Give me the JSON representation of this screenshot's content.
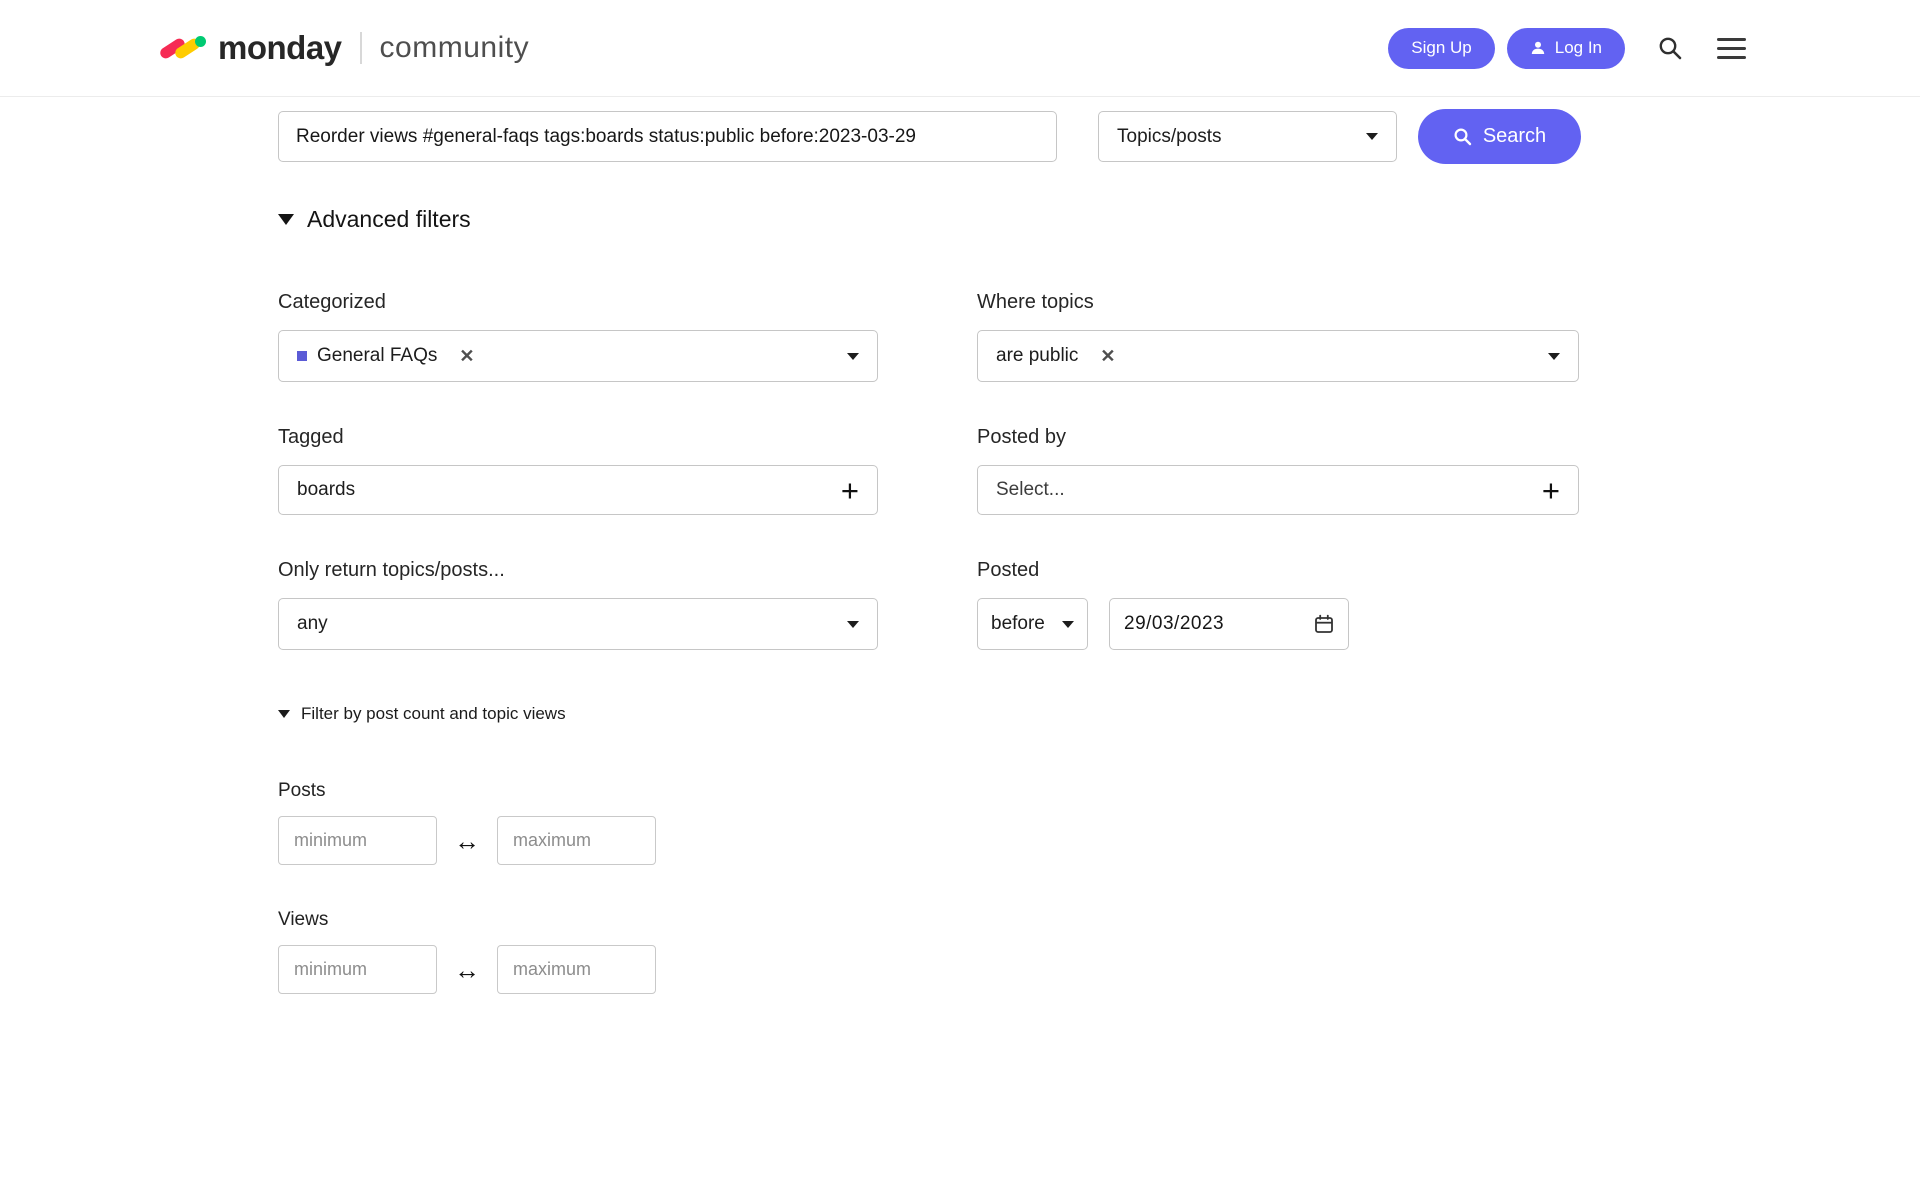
{
  "colors": {
    "accent": "#6262f2",
    "category_square": "#5b5bd6",
    "logo_red": "#f62b54",
    "logo_yellow": "#ffcc00",
    "logo_green": "#00ca72"
  },
  "header": {
    "brand": "monday",
    "brand_sub": "community",
    "signup": "Sign Up",
    "login": "Log In"
  },
  "search": {
    "query": "Reorder views #general-faqs tags:boards status:public before:2023-03-29",
    "type": "Topics/posts",
    "button": "Search"
  },
  "filters": {
    "title": "Advanced filters",
    "categorized_label": "Categorized",
    "categorized_value": "General FAQs",
    "where_label": "Where topics",
    "where_value": "are public",
    "tagged_label": "Tagged",
    "tagged_value": "boards",
    "posted_by_label": "Posted by",
    "posted_by_placeholder": "Select...",
    "only_label": "Only return topics/posts...",
    "only_value": "any",
    "posted_label": "Posted",
    "posted_condition": "before",
    "posted_date": "29/03/2023",
    "count_toggle": "Filter by post count and topic views",
    "posts_label": "Posts",
    "views_label": "Views",
    "min_placeholder": "minimum",
    "max_placeholder": "maximum"
  }
}
